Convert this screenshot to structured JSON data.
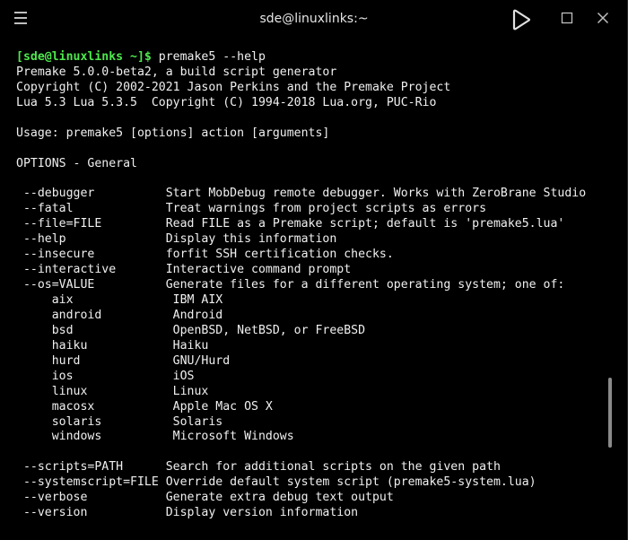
{
  "window": {
    "title": "sde@linuxlinks:~"
  },
  "terminal": {
    "prompt": "[sde@linuxlinks ~]$",
    "command": " premake5 --help",
    "lines": [
      "Premake 5.0.0-beta2, a build script generator",
      "Copyright (C) 2002-2021 Jason Perkins and the Premake Project",
      "Lua 5.3 Lua 5.3.5  Copyright (C) 1994-2018 Lua.org, PUC-Rio",
      "",
      "Usage: premake5 [options] action [arguments]",
      "",
      "OPTIONS - General",
      "",
      " --debugger          Start MobDebug remote debugger. Works with ZeroBrane Studio",
      " --fatal             Treat warnings from project scripts as errors",
      " --file=FILE         Read FILE as a Premake script; default is 'premake5.lua'",
      " --help              Display this information",
      " --insecure          forfit SSH certification checks.",
      " --interactive       Interactive command prompt",
      " --os=VALUE          Generate files for a different operating system; one of:",
      "     aix              IBM AIX",
      "     android          Android",
      "     bsd              OpenBSD, NetBSD, or FreeBSD",
      "     haiku            Haiku",
      "     hurd             GNU/Hurd",
      "     ios              iOS",
      "     linux            Linux",
      "     macosx           Apple Mac OS X",
      "     solaris          Solaris",
      "     windows          Microsoft Windows",
      "",
      " --scripts=PATH      Search for additional scripts on the given path",
      " --systemscript=FILE Override default system script (premake5-system.lua)",
      " --verbose           Generate extra debug text output",
      " --version           Display version information"
    ]
  },
  "colors": {
    "background": "#000000",
    "text": "#f0f0f0",
    "prompt": "#4ee84e",
    "chrome_icon": "#bfbfbf"
  },
  "icons": {
    "menu": "hamburger-menu-icon",
    "minimize": "minimize-icon",
    "maximize": "maximize-icon",
    "close": "close-icon"
  }
}
